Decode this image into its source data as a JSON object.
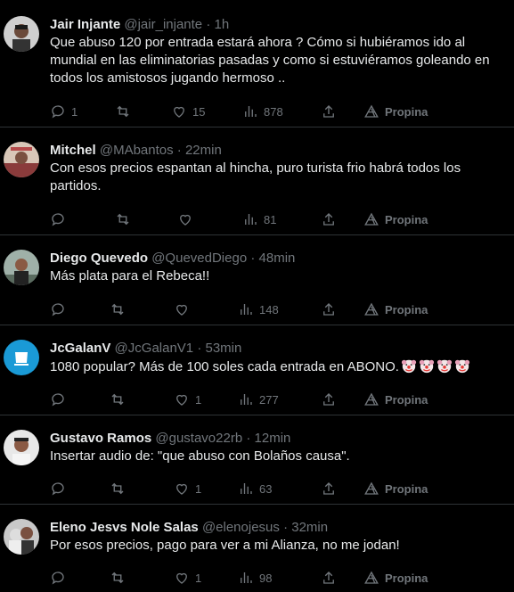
{
  "tweets": [
    {
      "name": "Jair Injante",
      "handle": "@jair_injante",
      "time": "1h",
      "text": "Que abuso 120 por entrada estará ahora ? Cómo si hubiéramos ido al mundial en las eliminatorias pasadas y como si estuviéramos goleando en todos los amistosos jugando hermoso ..",
      "replies": "1",
      "retweets": "",
      "likes": "15",
      "views": "878",
      "tip": "Propina"
    },
    {
      "name": "Mitchel",
      "handle": "@MAbantos",
      "time": "22min",
      "text": "Con esos precios espantan al hincha, puro turista frio habrá todos los partidos.",
      "replies": "",
      "retweets": "",
      "likes": "",
      "views": "81",
      "tip": "Propina"
    },
    {
      "name": "Diego Quevedo",
      "handle": "@QuevedDiego",
      "time": "48min",
      "text": "Más plata para el Rebeca!!",
      "replies": "",
      "retweets": "",
      "likes": "",
      "views": "148",
      "tip": "Propina"
    },
    {
      "name": "JcGalanV",
      "handle": "@JcGalanV1",
      "time": "53min",
      "text": "1080 popular? Más de 100 soles cada entrada en ABONO.",
      "emoji": "clown-face-emoji x4",
      "replies": "",
      "retweets": "",
      "likes": "1",
      "views": "277",
      "tip": "Propina"
    },
    {
      "name": "Gustavo Ramos",
      "handle": "@gustavo22rb",
      "time": "12min",
      "text": "Insertar audio de: \"que abuso con Bolaños causa\".",
      "replies": "",
      "retweets": "",
      "likes": "1",
      "views": "63",
      "tip": "Propina"
    },
    {
      "name": "Eleno Jesvs Nole Salas",
      "handle": "@elenojesus",
      "time": "32min",
      "text": "Por esos precios, pago para ver a mi Alianza, no me jodan!",
      "replies": "",
      "retweets": "",
      "likes": "1",
      "views": "98",
      "tip": "Propina"
    }
  ],
  "separator": "·",
  "colors": {
    "background": "#000000",
    "text": "#e7e9ea",
    "muted": "#71767b",
    "border": "#2f3336"
  },
  "icons": [
    "reply-icon",
    "retweet-icon",
    "like-icon",
    "views-icon",
    "share-icon",
    "tip-icon"
  ]
}
